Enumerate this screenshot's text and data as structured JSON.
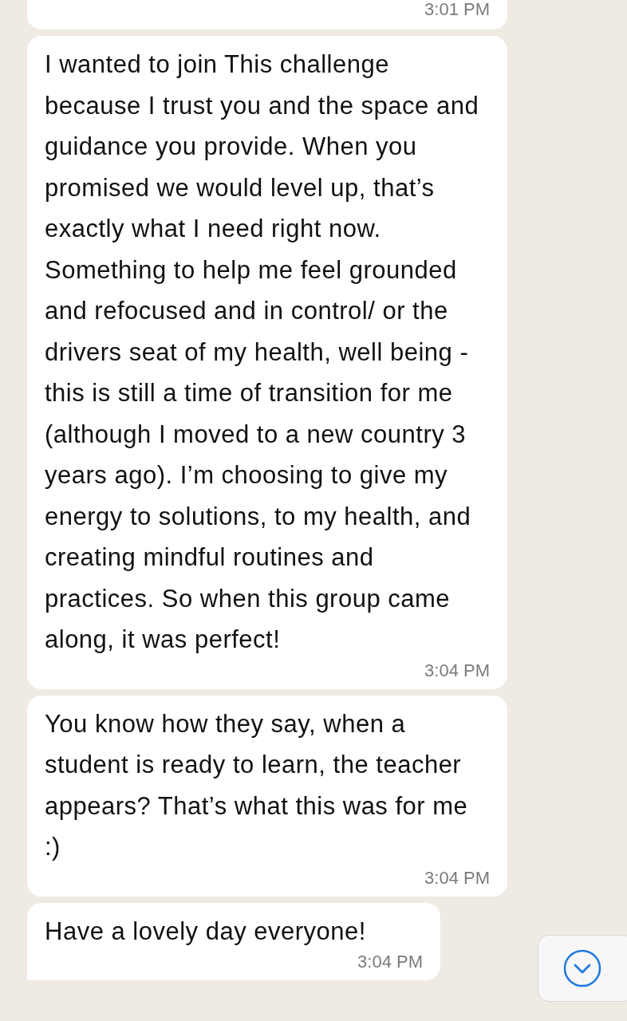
{
  "messages": [
    {
      "kind": "cut",
      "time": "3:01 PM"
    },
    {
      "kind": "text",
      "text": "I wanted to join This challenge because I trust you and the space and guidance you provide. When you promised we would level up, that’s exactly what I need right now. Something to help me feel grounded and refocused and in control/ or the drivers seat of my health, well being - this is still a time of transition for me (although I moved to a new country 3 years ago). I’m choosing to give my energy to solutions, to my health, and creating mindful routines and practices. So when this group came along, it was perfect!",
      "time": "3:04 PM",
      "tail": false
    },
    {
      "kind": "text",
      "text": "You know how they say, when a student is ready to learn, the teacher appears? That’s what this was for me :)",
      "time": "3:04 PM",
      "tail": false
    },
    {
      "kind": "text",
      "text": "Have a lovely day everyone!",
      "time": "3:04 PM",
      "tail": true
    }
  ]
}
